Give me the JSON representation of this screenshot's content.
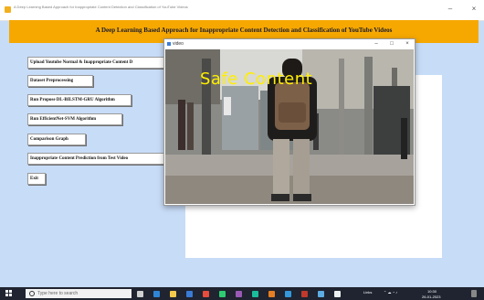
{
  "app": {
    "title": "A Deep Learning Based Approach for Inappropriate Content Detection and Classification of YouTube Videos",
    "controls": {
      "minimize": "–",
      "close": "×"
    }
  },
  "banner": {
    "text": "A Deep Learning Based Approach for Inappropriate Content Detection and Classification of YouTube Videos"
  },
  "buttons": [
    "Upload Youtube Normal & Inappropriate Content D",
    "Dataset Preprocessing",
    "Run Propose DL-BILSTM-GRU Algorithm",
    "Run EfficientNet-SVM Algorithm",
    "Comparison Graph",
    "Inappropriate Content Prediction from Test Video",
    "Exit"
  ],
  "video_window": {
    "title": "video",
    "controls": {
      "minimize": "–",
      "maximize": "□",
      "close": "×"
    },
    "overlay": "Safe Content",
    "overlay_color": "#ffef00"
  },
  "taskbar": {
    "search_placeholder": "Type here to search",
    "tray_text": "Links",
    "clock_time": "10:30",
    "clock_date": "26-01-2023"
  }
}
